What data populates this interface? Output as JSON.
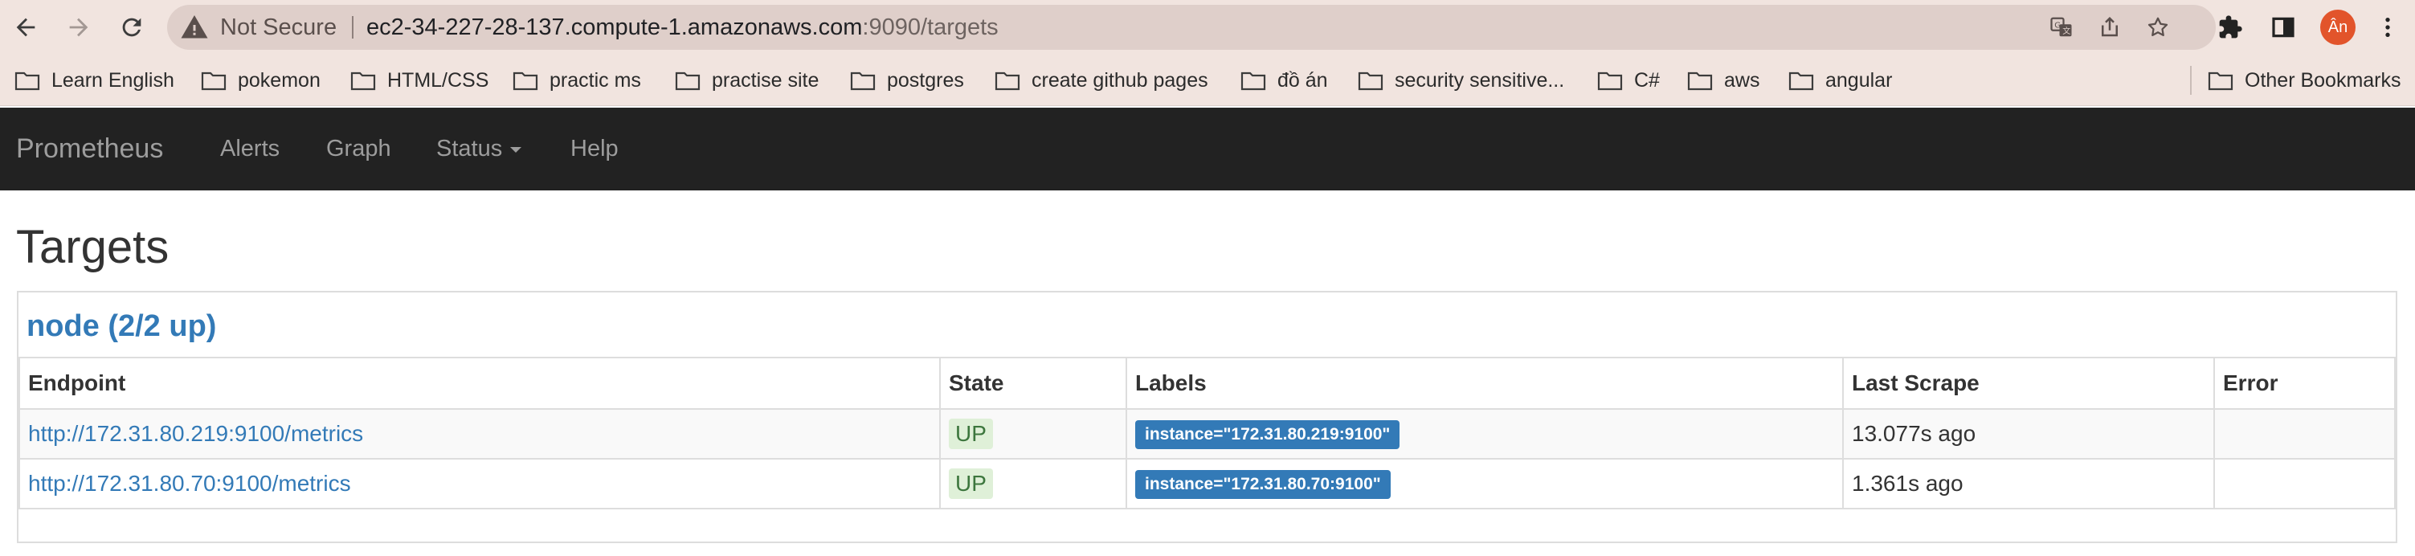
{
  "browser": {
    "security_label": "Not Secure",
    "url_host": "ec2-34-227-28-137.compute-1.amazonaws.com",
    "url_rest": ":9090/targets",
    "avatar_text": "Ân",
    "nav_icons": [
      "back-arrow-icon",
      "forward-arrow-icon",
      "reload-icon"
    ],
    "omnibox_icons": [
      "warning-triangle-icon",
      "translate-icon",
      "share-icon",
      "star-icon"
    ],
    "toolbar_icons": [
      "extensions-puzzle-icon",
      "side-panel-icon",
      "more-vert-icon"
    ]
  },
  "bookmarks": {
    "items": [
      {
        "label": "Learn English"
      },
      {
        "label": "pokemon"
      },
      {
        "label": "HTML/CSS"
      },
      {
        "label": "practic ms"
      },
      {
        "label": "practise site"
      },
      {
        "label": "postgres"
      },
      {
        "label": "create github pages"
      },
      {
        "label": "đồ án"
      },
      {
        "label": "security sensitive..."
      },
      {
        "label": "C#"
      },
      {
        "label": "aws"
      },
      {
        "label": "angular"
      }
    ],
    "other": "Other Bookmarks"
  },
  "navbar": {
    "brand": "Prometheus",
    "links": [
      "Alerts",
      "Graph",
      "Status",
      "Help"
    ]
  },
  "page": {
    "title": "Targets",
    "job_title": "node (2/2 up)",
    "columns": [
      "Endpoint",
      "State",
      "Labels",
      "Last Scrape",
      "Error"
    ],
    "rows": [
      {
        "endpoint": "http://172.31.80.219:9100/metrics",
        "state": "UP",
        "labels": "instance=\"172.31.80.219:9100\"",
        "last_scrape": "13.077s ago",
        "error": ""
      },
      {
        "endpoint": "http://172.31.80.70:9100/metrics",
        "state": "UP",
        "labels": "instance=\"172.31.80.70:9100\"",
        "last_scrape": "1.361s ago",
        "error": ""
      }
    ]
  },
  "colors": {
    "browser_chrome": "#f1e4df",
    "omnibox": "#dfcfca",
    "navbar": "#222222",
    "link": "#337ab7",
    "state_up_bg": "#dff0d8",
    "state_up_text": "#3c763d",
    "avatar": "#e2542b"
  }
}
